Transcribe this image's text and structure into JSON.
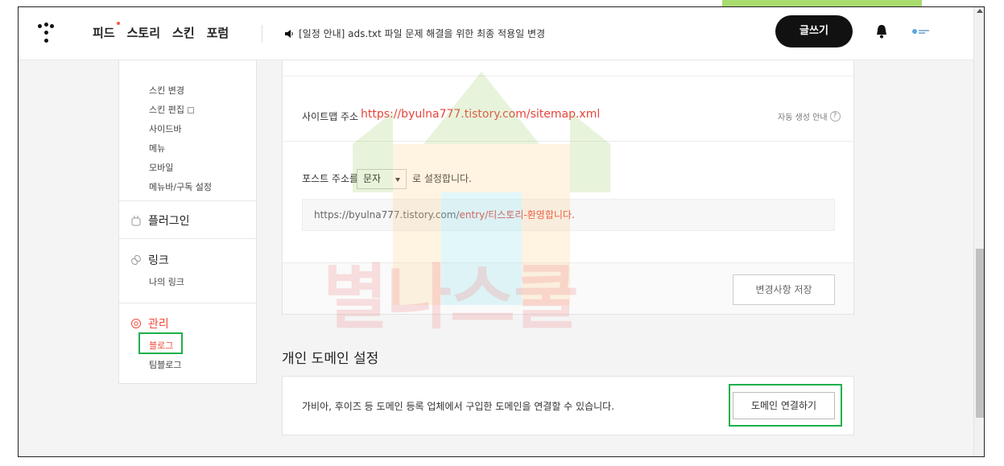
{
  "header": {
    "nav": [
      {
        "label": "피드",
        "dot": true
      },
      {
        "label": "스토리",
        "dot": false
      },
      {
        "label": "스킨",
        "dot": false
      },
      {
        "label": "포럼",
        "dot": false
      }
    ],
    "notice": "[일정 안내] ads.txt 파일 문제 해결을 위한 최종 적용일 변경",
    "write_label": "글쓰기"
  },
  "sidebar": {
    "top_items": [
      "스킨 변경",
      "스킨 편집",
      "사이드바",
      "메뉴",
      "모바일",
      "메뉴바/구독 설정"
    ],
    "plugin": {
      "label": "플러그인"
    },
    "link": {
      "label": "링크",
      "items": [
        "나의 링크"
      ]
    },
    "manage": {
      "label": "관리",
      "items": [
        "블로그",
        "팀블로그"
      ]
    }
  },
  "main": {
    "sitemap_label": "사이트맵 주소",
    "sitemap_url": "https://byulna777.tistory.com/sitemap.xml",
    "sitemap_help": "자동 생성 안내",
    "post_label_before": "포스트 주소를",
    "post_select": "문자",
    "post_label_after": "로 설정합니다.",
    "preview_base": "https://byulna777.tistory.com/",
    "preview_path": "entry/티스토리-환영합니다.",
    "save_label": "변경사항 저장",
    "domain_title": "개인 도메인 설정",
    "domain_text": "가비아, 후이즈 등 도메인 등록 업체에서 구입한 도메인을 연결할 수 있습니다.",
    "connect_label": "도메인 연결하기"
  },
  "colors": {
    "accent": "#e8433a",
    "highlight": "#1db14b",
    "dark": "#111111"
  }
}
